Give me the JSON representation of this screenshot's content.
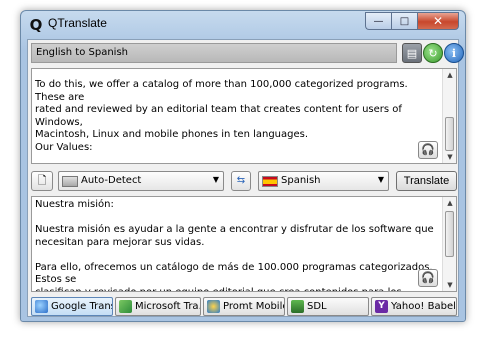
{
  "window": {
    "title": "QTranslate",
    "icon": "Q"
  },
  "caption_buttons": {
    "minimize": "—",
    "maximize": "□",
    "close": "✕"
  },
  "lang_pair": "English to Spanish",
  "source_text": "To do this, we offer a catalog of more than 100,000 categorized programs. These are\nrated and reviewed by an editorial team that creates content for users of Windows,\nMacintosh, Linux and mobile phones in ten languages.\nOur Values:\n\nOur work is based on credibility, team spirit, personal responsibility, the desire to exceed\nand believing in and respecting people.",
  "toolbar": {
    "source_lang": "Auto-Detect",
    "target_lang": "Spanish",
    "translate_label": "Translate"
  },
  "translated_text": "Nuestra misión:\n\nNuestra misión es ayudar a la gente a encontrar y disfrutar de los software que\nnecesitan para mejorar sus vidas.\n\nPara ello, ofrecemos un catálogo de más de 100.000 programas categorizados. Estos se\nclasifican y revisado por un equipo editorial que crea contenidos para los usuarios de\nWindows, Macintosh, Linux y teléfonos móviles en diez idiomas.",
  "services": [
    {
      "label": "Google Trans...",
      "active": true,
      "icon": "google-translate-icon"
    },
    {
      "label": "Microsoft Tra...",
      "active": false,
      "icon": "microsoft-translator-icon"
    },
    {
      "label": "Promt Mobile",
      "active": false,
      "icon": "promt-icon"
    },
    {
      "label": "SDL",
      "active": false,
      "icon": "sdl-icon"
    },
    {
      "label": "Yahoo! Babel ...",
      "active": false,
      "icon": "yahoo-icon"
    }
  ],
  "colors": {
    "accent": "#2266bb",
    "close": "#c8472c",
    "active_tab": "#c5def5"
  }
}
